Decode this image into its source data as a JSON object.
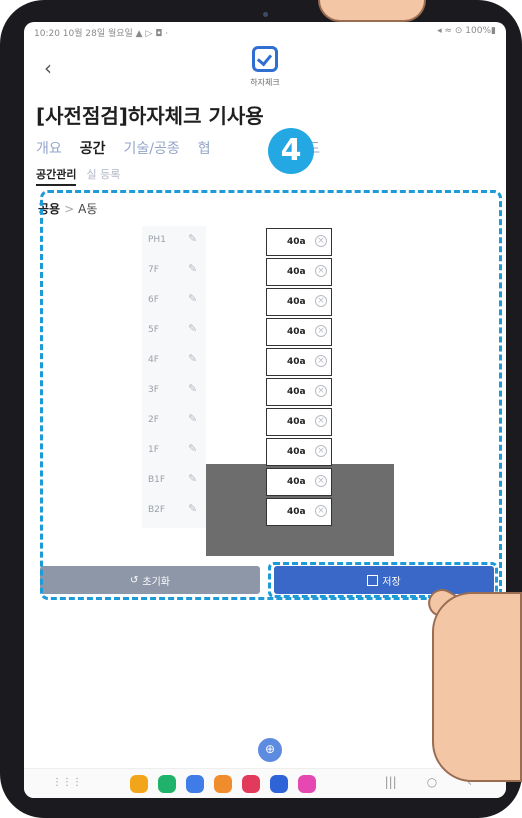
{
  "status_bar": {
    "left": "10:20  10월 28일 월요일  ▲ ▷ ◘ ·",
    "right": "◂ ≈ ⊙ 100%▮"
  },
  "header": {
    "back_icon": "back-chevron",
    "app_name": "하자체크",
    "title": "[사전점검]하자체크 기사용"
  },
  "tabs": [
    {
      "label": "개요",
      "active": false
    },
    {
      "label": "공간",
      "active": true
    },
    {
      "label": "기술/공종",
      "active": false
    },
    {
      "label": "협",
      "active": false
    },
    {
      "label": "드로보드",
      "active": false
    }
  ],
  "subtabs": [
    {
      "label": "공간관리",
      "active": true
    },
    {
      "label": "실 등록",
      "active": false
    }
  ],
  "step_badge": "4",
  "breadcrumb": {
    "root": "공용",
    "separator": ">",
    "current": "A동"
  },
  "floors": [
    {
      "label": "PH1",
      "space": "40a"
    },
    {
      "label": "7F",
      "space": "40a"
    },
    {
      "label": "6F",
      "space": "40a"
    },
    {
      "label": "5F",
      "space": "40a"
    },
    {
      "label": "4F",
      "space": "40a"
    },
    {
      "label": "3F",
      "space": "40a"
    },
    {
      "label": "2F",
      "space": "40a"
    },
    {
      "label": "1F",
      "space": "40a"
    },
    {
      "label": "B1F",
      "space": "40a"
    },
    {
      "label": "B2F",
      "space": "40a"
    }
  ],
  "buttons": {
    "reset_label": "초기화",
    "reset_icon": "↺",
    "save_label": "저장"
  },
  "fab_icon": "⊕",
  "colors": {
    "accent": "#3a68c9",
    "annotation": "#1e9ad8",
    "badge": "#24a8e3",
    "reset": "#8e97a8"
  }
}
